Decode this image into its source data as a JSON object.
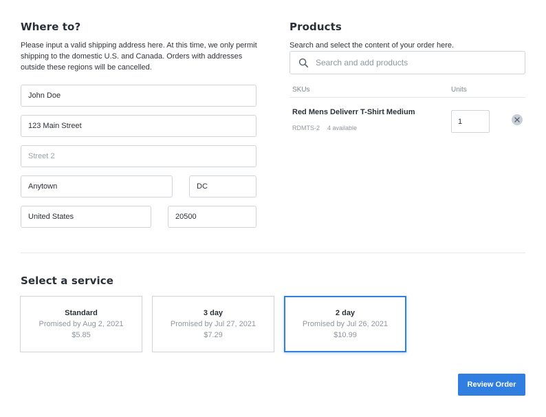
{
  "address": {
    "title": "Where to?",
    "description": "Please input a valid shipping address here. At this time, we only permit shipping to the domestic U.S. and Canada. Orders with addresses outside these regions will be cancelled.",
    "name_value": "John Doe",
    "street1_value": "123 Main Street",
    "street2_placeholder": "Street 2",
    "city_value": "Anytown",
    "state_value": "DC",
    "country_value": "United States",
    "zip_value": "20500"
  },
  "products": {
    "title": "Products",
    "description": "Search and select the content of your order here.",
    "search_placeholder": "Search and add products",
    "search_icon": "search-icon",
    "columns": {
      "skus": "SKUs",
      "units": "Units"
    },
    "items": [
      {
        "name": "Red Mens Deliverr T-Shirt Medium",
        "sku": "RDMTS-2",
        "available": "4 available",
        "units": "1",
        "remove_icon": "close-icon"
      }
    ]
  },
  "service": {
    "title": "Select a service",
    "selected_index": 2,
    "options": [
      {
        "name": "Standard",
        "promise": "Promised by Aug 2, 2021",
        "price": "$5.85"
      },
      {
        "name": "3 day",
        "promise": "Promised by Jul 27, 2021",
        "price": "$7.29"
      },
      {
        "name": "2 day",
        "promise": "Promised by Jul 26, 2021",
        "price": "$10.99"
      }
    ]
  },
  "actions": {
    "review_label": "Review Order"
  },
  "colors": {
    "accent": "#2f7ee0",
    "border": "#cfd4db",
    "muted_text": "#8f96a0"
  }
}
